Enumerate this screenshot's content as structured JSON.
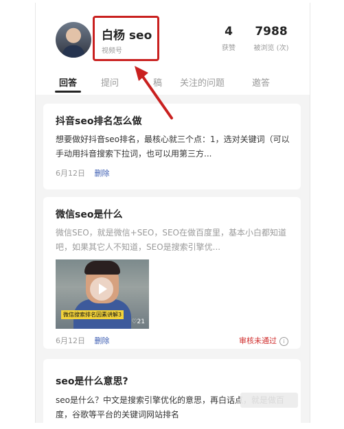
{
  "profile": {
    "name": "白杨 seo",
    "subtitle": "视频号",
    "likes_value": "4",
    "likes_label": "获赞",
    "views_value": "7988",
    "views_label": "被浏览 (次)"
  },
  "tabs": [
    {
      "label": "回答"
    },
    {
      "label": "提问"
    },
    {
      "label": "稿"
    },
    {
      "label": "关注的问题"
    },
    {
      "label": "邀答"
    }
  ],
  "cards": [
    {
      "title": "抖音seo排名怎么做",
      "text": "想要做好抖音seo排名，最核心就三个点：1，选对关键词（可以手动用抖音搜索下拉词，也可以用第三方...",
      "date": "6月12日",
      "delete_label": "删除"
    },
    {
      "title": "微信seo是什么",
      "text": "微信SEO，就是微信+SEO，SEO在做百度里，基本小白都知道吧，如果其它人不知道，SEO是搜索引擎优...",
      "thumbnail_caption": "微信搜索排名因素讲解3",
      "thumbnail_count": "♡21",
      "date": "6月12日",
      "delete_label": "删除",
      "status": "审核未通过"
    },
    {
      "title": "seo是什么意思?",
      "text": "seo是什么？中文是搜索引擎优化的意思，再白话点，就是做百度，谷歌等平台的关键词网站排名"
    }
  ],
  "colors": {
    "highlight_red": "#c9201f",
    "link_blue": "#3a5bb1",
    "status_red": "#d0302f"
  }
}
